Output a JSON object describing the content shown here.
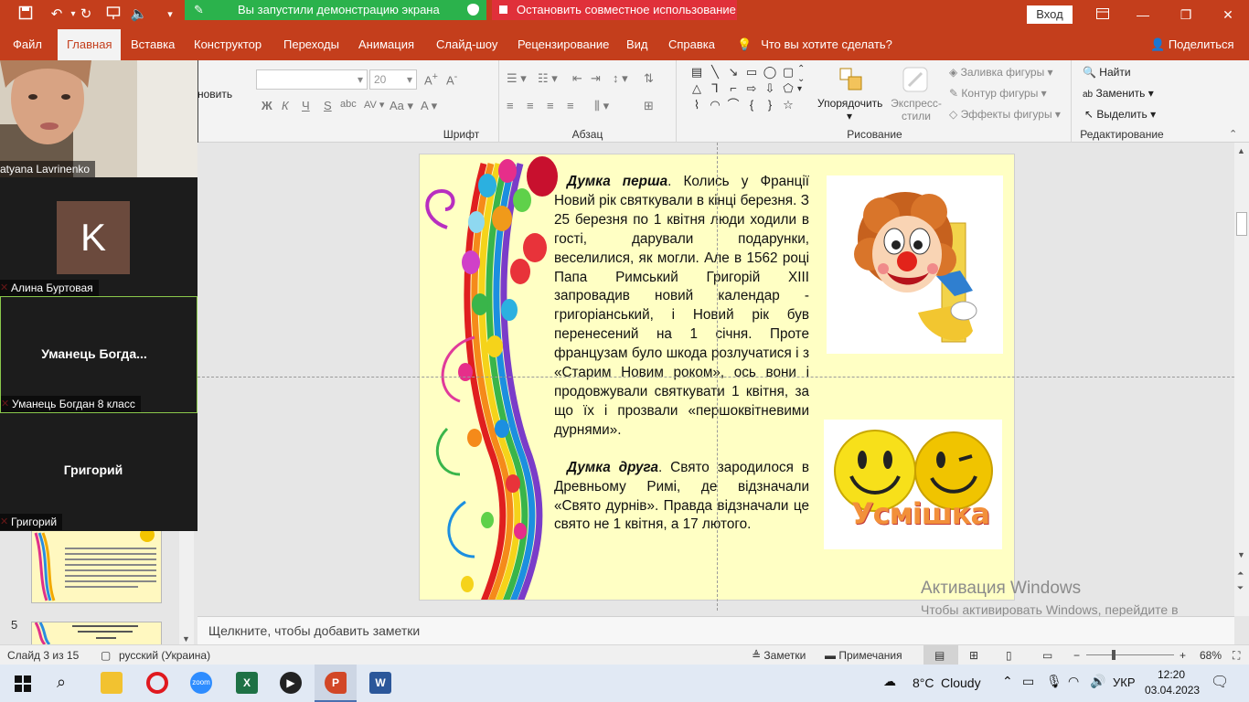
{
  "titlebar": {
    "share_banner": "Вы запустили демонстрацию экрана",
    "stop_banner": "Остановить совместное использование",
    "signin": "Вход"
  },
  "tabs": [
    "Файл",
    "Главная",
    "Вставка",
    "Конструктор",
    "Переходы",
    "Анимация",
    "Слайд-шоу",
    "Рецензирование",
    "Вид",
    "Справка"
  ],
  "tell_me": "Что вы хотите сделать?",
  "share": "Поделиться",
  "ribbon": {
    "restore_partial": "новить",
    "font_size": "20",
    "groups": {
      "font": "Шрифт",
      "paragraph": "Абзац",
      "drawing": "Рисование",
      "editing": "Редактирование"
    },
    "arrange": "Упорядочить",
    "quick_styles": "Экспресс-стили",
    "shape_fill": "Заливка фигуры",
    "shape_outline": "Контур фигуры",
    "shape_effects": "Эффекты фигуры",
    "find": "Найти",
    "replace": "Заменить",
    "select": "Выделить"
  },
  "video": {
    "participants": [
      {
        "name": "atyana Lavrinenko"
      },
      {
        "name": "Алина Буртовая",
        "initial": "K"
      },
      {
        "name": "Уманець Богдан 8 класс",
        "display": "Уманець  Богда..."
      },
      {
        "name": "Григорий",
        "display": "Григорий"
      }
    ]
  },
  "thumb5_num": "5",
  "slide": {
    "para1_title": "Думка перша",
    "para1_text": ". Колись у Франції Новий рік святкували в кінці березня. З 25 березня по 1 квітня люди ходили в гості, дарували подарунки, веселилися, як могли. Але в 1562 році Папа Римський Григорій XIII запровадив новий календар - григоріанський, і Новий рік був перенесений на 1 січня. Проте французам було шкода розлучатися і з «Старим Новим роком», ось вони і продовжували святкувати 1 квітня, за що їх і прозвали «першоквітневими дурнями».",
    "para2_title": "Думка друга",
    "para2_text": ". Свято зародилося в Древньому Римі, де відзначали «Свято дурнів». Правда відзначали це свято не  1 квітня, а 17 лютого.",
    "smile_word": "Усмішка"
  },
  "activation": {
    "title": "Активация Windows",
    "subtitle": "Чтобы активировать Windows, перейдите в раздел \"Параметры\"."
  },
  "notes_placeholder": "Щелкните, чтобы добавить заметки",
  "status": {
    "slide": "Слайд 3 из 15",
    "language": "русский (Украина)",
    "notes": "Заметки",
    "comments": "Примечания",
    "zoom": "68%"
  },
  "taskbar": {
    "temperature": "8°C",
    "weather": "Cloudy",
    "lang": "УКР",
    "time": "12:20",
    "date": "03.04.2023"
  },
  "colors": {
    "accent": "#c43e1c",
    "share_green": "#2bb24c",
    "stop_red": "#e0303a",
    "slide_bg": "#ffffc4"
  }
}
